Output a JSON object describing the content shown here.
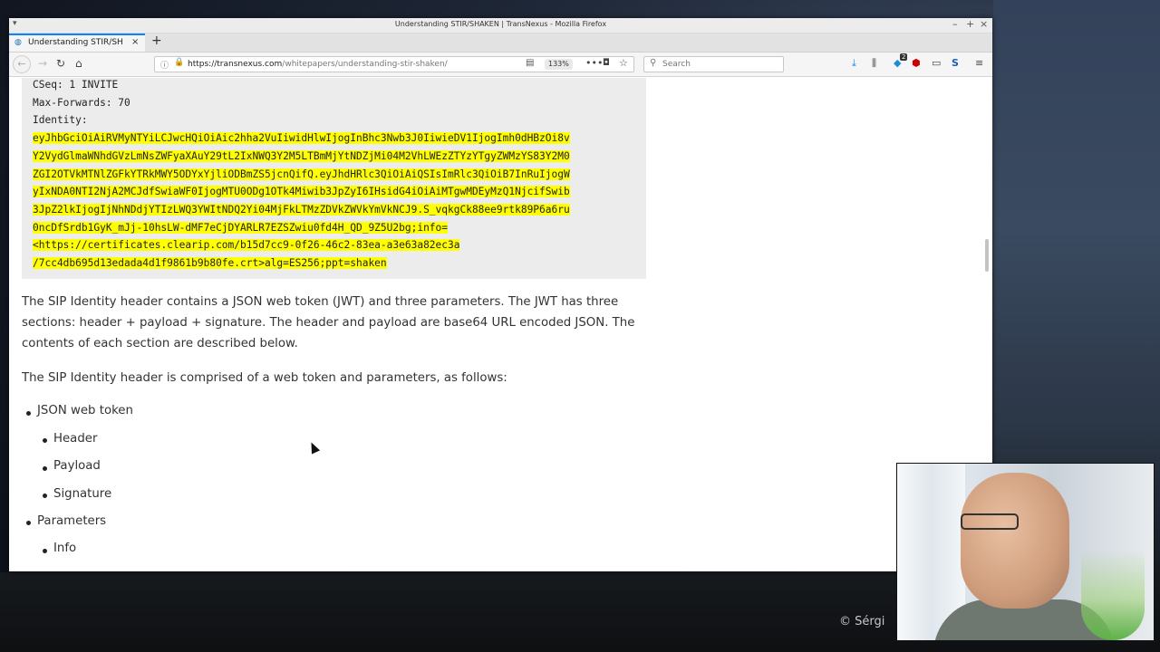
{
  "window": {
    "title": "Understanding STIR/SHAKEN | TransNexus - Mozilla Firefox",
    "controls": [
      "–",
      "+",
      "×"
    ]
  },
  "tab": {
    "label": "Understanding STIR/SHAKEN",
    "close": "×",
    "new_tab": "+"
  },
  "navbar": {
    "url_host": "https://transnexus.com",
    "url_path": "/whitepapers/understanding-stir-shaken/",
    "zoom": "133%",
    "search_placeholder": "Search"
  },
  "icons": {
    "back": "back-arrow-icon",
    "forward": "forward-arrow-icon",
    "reload": "reload-icon",
    "home": "home-icon",
    "download": "download-icon",
    "library": "library-icon",
    "extension_badge": "2"
  },
  "content": {
    "code_plain": [
      "CSeq: 1 INVITE",
      "Max-Forwards: 70",
      "Identity:"
    ],
    "code_highlighted": [
      "eyJhbGciOiAiRVMyNTYiLCJwcHQiOiAic2hha2VuIiwidHlwIjogInBhc3Nwb3J0IiwieDV1IjogImh0dHBzOi8v",
      "Y2VydGlmaWNhdGVzLmNsZWFyaXAuY29tL2IxNWQ3Y2M5LTBmMjYtNDZjMi04M2VhLWEzZTYzYTgyZWMzYS83Y2M0",
      "ZGI2OTVkMTNlZGFkYTRkMWY5ODYxYjliODBmZS5jcnQifQ.eyJhdHRlc3QiOiAiQSIsImRlc3QiOiB7InRuIjogW",
      "yIxNDA0NTI2NjA2MCJdfSwiaWF0IjogMTU0ODg1OTk4Miwib3JpZyI6IHsidG4iOiAiMTgwMDEyMzQ1NjcifSwib",
      "3JpZ2lkIjogIjNhNDdjYTIzLWQ3YWItNDQ2Yi04MjFkLTMzZDVkZWVkYmVkNCJ9.S_vqkgCk88ee9rtk89P6a6ru",
      "0ncDfSrdb1GyK_mJj-10hsLW-dMF7eCjDYARLR7EZSZwiu0fd4H_QD_9Z5U2bg;info=",
      "<https://certificates.clearip.com/b15d7cc9-0f26-46c2-83ea-a3e63a82ec3a",
      "/7cc4db695d13edada4d1f9861b9b80fe.crt>alg=ES256;ppt=shaken"
    ],
    "paragraph_1": "The SIP Identity header contains a JSON web token (JWT) and three parameters. The JWT has three sections: header + payload + signature. The header and payload are base64 URL encoded JSON. The contents of each section are described below.",
    "paragraph_2": "The SIP Identity header is comprised of a web token and parameters, as follows:",
    "list": {
      "jwt": "JSON web token",
      "jwt_items": [
        "Header",
        "Payload",
        "Signature"
      ],
      "params": "Parameters",
      "param_items": [
        "Info"
      ]
    }
  },
  "desktop": {
    "copyright": "© Sérgi"
  }
}
